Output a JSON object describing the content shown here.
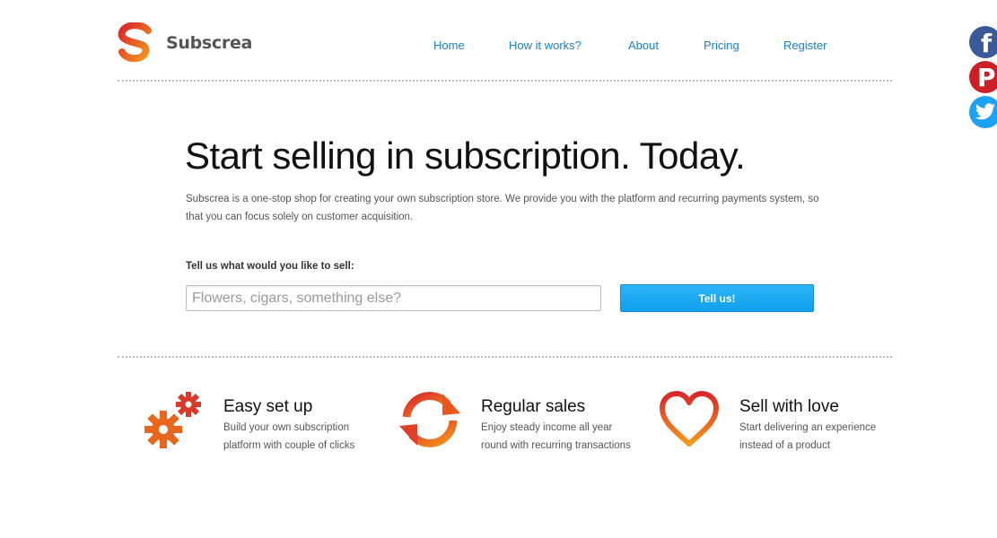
{
  "brand": {
    "name": "Subscrea",
    "colors": {
      "orange": "#f28c1f",
      "red": "#d2302b",
      "link": "#1a7fc9",
      "button": "#1aa6f2"
    }
  },
  "nav": [
    {
      "label": "Home"
    },
    {
      "label": "How it works?"
    },
    {
      "label": "About"
    },
    {
      "label": "Pricing"
    },
    {
      "label": "Register"
    }
  ],
  "social": [
    {
      "name": "facebook",
      "icon": "facebook-icon"
    },
    {
      "name": "pinterest",
      "icon": "pinterest-icon"
    },
    {
      "name": "twitter",
      "icon": "twitter-icon"
    }
  ],
  "hero": {
    "title": "Start selling in subscription. Today.",
    "description": "Subscrea is a one-stop shop for creating your own subscription store. We provide you with the platform and recurring payments system, so that you can focus solely on customer acquisition.",
    "prompt_label": "Tell us what would you like to sell:",
    "input_placeholder": "Flowers, cigars, something else?",
    "input_value": "",
    "button_label": "Tell us!"
  },
  "features": [
    {
      "icon": "gears-icon",
      "title": "Easy set up",
      "text": "Build your own subscription platform with couple of clicks"
    },
    {
      "icon": "refresh-icon",
      "title": "Regular sales",
      "text": "Enjoy steady income all year round with recurring transactions"
    },
    {
      "icon": "heart-icon",
      "title": "Sell with love",
      "text": "Start delivering an experience instead of a product"
    }
  ]
}
